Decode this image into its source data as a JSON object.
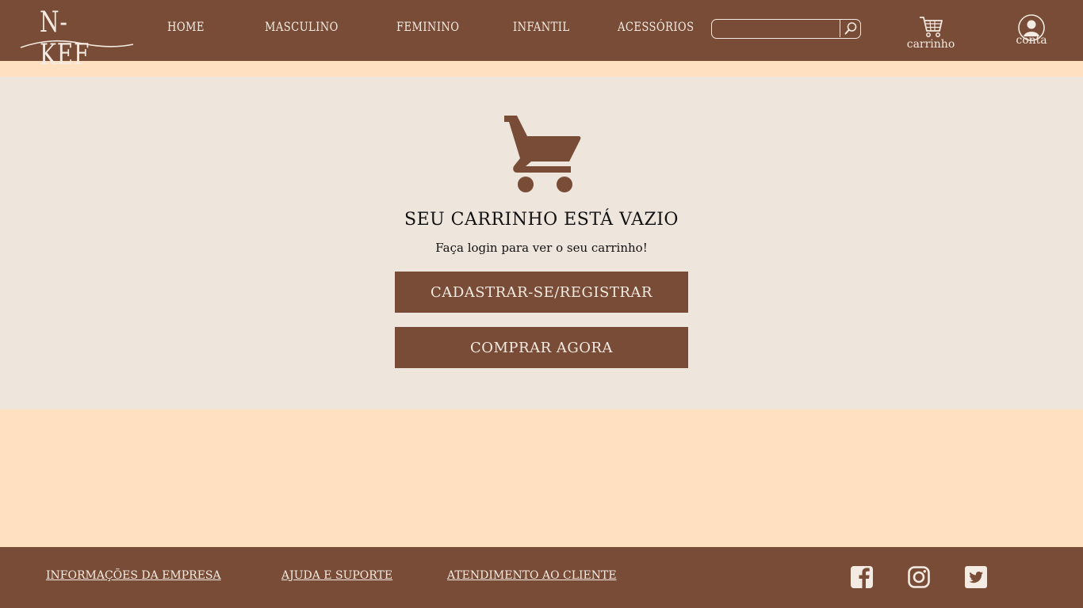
{
  "brand": {
    "logo_text": "N-KEF"
  },
  "nav": {
    "items": [
      {
        "label": "HOME"
      },
      {
        "label": "MASCULINO"
      },
      {
        "label": "FEMININO"
      },
      {
        "label": "INFANTIL"
      },
      {
        "label": "ACESSÓRIOS"
      }
    ]
  },
  "search": {
    "value": "",
    "placeholder": "",
    "icon": "search-icon"
  },
  "header_actions": {
    "cart_label": "carrinho",
    "account_label": "conta"
  },
  "cart": {
    "icon": "cart-icon",
    "title": "SEU CARRINHO ESTÁ VAZIO",
    "subtitle": "Faça login para ver o seu carrinho!",
    "register_button": "CADASTRAR-SE/REGISTRAR",
    "buy_button": "COMPRAR AGORA"
  },
  "footer": {
    "links": [
      {
        "label": "INFORMAÇÕES DA EMPRESA"
      },
      {
        "label": "AJUDA E SUPORTE"
      },
      {
        "label": "ATENDIMENTO AO CLIENTE"
      }
    ],
    "social": [
      "facebook-icon",
      "instagram-icon",
      "twitter-icon"
    ]
  },
  "colors": {
    "brand_brown": "#784C37",
    "panel_bg": "#EEE5DD",
    "page_bg": "#FFE1C2",
    "light_text": "#F4EBE2"
  }
}
